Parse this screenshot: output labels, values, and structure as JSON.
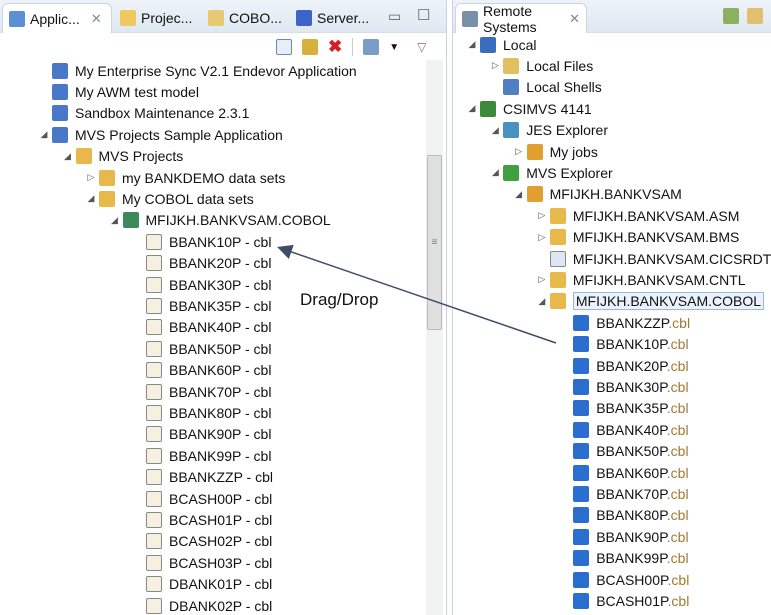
{
  "left_panel": {
    "tabs": [
      {
        "label": "Applic...",
        "active": true
      },
      {
        "label": "Projec..."
      },
      {
        "label": "COBO..."
      },
      {
        "label": "Server..."
      }
    ],
    "tree": [
      {
        "label": "My Enterprise Sync V2.1 Endevor Application",
        "level": 0,
        "icon": "app-icon",
        "arrow": ""
      },
      {
        "label": "My AWM test model",
        "level": 0,
        "icon": "app-icon",
        "arrow": ""
      },
      {
        "label": "Sandbox Maintenance 2.3.1",
        "level": 0,
        "icon": "app-icon",
        "arrow": ""
      },
      {
        "label": "MVS Projects Sample Application",
        "level": 0,
        "icon": "app-icon",
        "arrow": "open"
      },
      {
        "label": "MVS Projects",
        "level": 1,
        "icon": "folder-icon",
        "arrow": "open"
      },
      {
        "label": "my BANKDEMO data sets",
        "level": 2,
        "icon": "folder-icon",
        "arrow": "closed"
      },
      {
        "label": "My COBOL data sets",
        "level": 2,
        "icon": "folder-icon",
        "arrow": "open"
      },
      {
        "label": "MFIJKH.BANKVSAM.COBOL",
        "level": 3,
        "icon": "dataset-icon",
        "arrow": "open"
      },
      {
        "label": "BBANK10P - cbl",
        "level": 4,
        "icon": "file-icon"
      },
      {
        "label": "BBANK20P - cbl",
        "level": 4,
        "icon": "file-icon"
      },
      {
        "label": "BBANK30P - cbl",
        "level": 4,
        "icon": "file-icon"
      },
      {
        "label": "BBANK35P - cbl",
        "level": 4,
        "icon": "file-icon"
      },
      {
        "label": "BBANK40P - cbl",
        "level": 4,
        "icon": "file-icon"
      },
      {
        "label": "BBANK50P - cbl",
        "level": 4,
        "icon": "file-icon"
      },
      {
        "label": "BBANK60P - cbl",
        "level": 4,
        "icon": "file-icon"
      },
      {
        "label": "BBANK70P - cbl",
        "level": 4,
        "icon": "file-icon"
      },
      {
        "label": "BBANK80P - cbl",
        "level": 4,
        "icon": "file-icon"
      },
      {
        "label": "BBANK90P - cbl",
        "level": 4,
        "icon": "file-icon"
      },
      {
        "label": "BBANK99P - cbl",
        "level": 4,
        "icon": "file-icon"
      },
      {
        "label": "BBANKZZP - cbl",
        "level": 4,
        "icon": "file-icon"
      },
      {
        "label": "BCASH00P - cbl",
        "level": 4,
        "icon": "file-icon"
      },
      {
        "label": "BCASH01P - cbl",
        "level": 4,
        "icon": "file-icon"
      },
      {
        "label": "BCASH02P - cbl",
        "level": 4,
        "icon": "file-icon"
      },
      {
        "label": "BCASH03P - cbl",
        "level": 4,
        "icon": "file-icon"
      },
      {
        "label": "DBANK01P - cbl",
        "level": 4,
        "icon": "file-icon"
      },
      {
        "label": "DBANK02P - cbl",
        "level": 4,
        "icon": "file-icon"
      }
    ]
  },
  "right_panel": {
    "tab": "Remote Systems",
    "tree": [
      {
        "label": "Local",
        "level": 0,
        "arrow": "open",
        "icon": "local-icon"
      },
      {
        "label": "Local Files",
        "level": 1,
        "arrow": "closed",
        "icon": "local-files-icon"
      },
      {
        "label": "Local Shells",
        "level": 1,
        "arrow": "",
        "icon": "local-shells-icon"
      },
      {
        "label": "CSIMVS 4141",
        "level": 0,
        "arrow": "open",
        "icon": "server-icon"
      },
      {
        "label": "JES Explorer",
        "level": 1,
        "arrow": "open",
        "icon": "jes-icon"
      },
      {
        "label": "My jobs",
        "level": 2,
        "arrow": "closed",
        "icon": "filter-icon"
      },
      {
        "label": "MVS Explorer",
        "level": 1,
        "arrow": "open",
        "icon": "mvs-icon"
      },
      {
        "label": "MFIJKH.BANKVSAM",
        "level": 2,
        "arrow": "open",
        "icon": "filter-icon"
      },
      {
        "label": "MFIJKH.BANKVSAM.ASM",
        "level": 3,
        "arrow": "closed",
        "icon": "folder-icon"
      },
      {
        "label": "MFIJKH.BANKVSAM.BMS",
        "level": 3,
        "arrow": "closed",
        "icon": "folder-icon"
      },
      {
        "label": "MFIJKH.BANKVSAM.CICSRDT",
        "level": 3,
        "arrow": "",
        "icon": "doc-icon"
      },
      {
        "label": "MFIJKH.BANKVSAM.CNTL",
        "level": 3,
        "arrow": "closed",
        "icon": "folder-icon"
      },
      {
        "label": "MFIJKH.BANKVSAM.COBOL",
        "level": 3,
        "arrow": "open",
        "icon": "folder-icon",
        "selected": true
      },
      {
        "label": "BBANKZZP",
        "ext": ".cbl",
        "level": 4,
        "icon": "member-icon"
      },
      {
        "label": "BBANK10P",
        "ext": ".cbl",
        "level": 4,
        "icon": "member-icon"
      },
      {
        "label": "BBANK20P",
        "ext": ".cbl",
        "level": 4,
        "icon": "member-icon"
      },
      {
        "label": "BBANK30P",
        "ext": ".cbl",
        "level": 4,
        "icon": "member-icon"
      },
      {
        "label": "BBANK35P",
        "ext": ".cbl",
        "level": 4,
        "icon": "member-icon"
      },
      {
        "label": "BBANK40P",
        "ext": ".cbl",
        "level": 4,
        "icon": "member-icon"
      },
      {
        "label": "BBANK50P",
        "ext": ".cbl",
        "level": 4,
        "icon": "member-icon"
      },
      {
        "label": "BBANK60P",
        "ext": ".cbl",
        "level": 4,
        "icon": "member-icon"
      },
      {
        "label": "BBANK70P",
        "ext": ".cbl",
        "level": 4,
        "icon": "member-icon"
      },
      {
        "label": "BBANK80P",
        "ext": ".cbl",
        "level": 4,
        "icon": "member-icon"
      },
      {
        "label": "BBANK90P",
        "ext": ".cbl",
        "level": 4,
        "icon": "member-icon"
      },
      {
        "label": "BBANK99P",
        "ext": ".cbl",
        "level": 4,
        "icon": "member-icon"
      },
      {
        "label": "BCASH00P",
        "ext": ".cbl",
        "level": 4,
        "icon": "member-icon"
      },
      {
        "label": "BCASH01P",
        "ext": ".cbl",
        "level": 4,
        "icon": "member-icon"
      }
    ]
  },
  "annotation": {
    "label": "Drag/Drop"
  },
  "colors": {
    "folder": "#e8b84a",
    "app": "#4a78c8",
    "member": "#2a6fd0",
    "server": "#3a8a3a",
    "arrow": "#3d4e66"
  }
}
